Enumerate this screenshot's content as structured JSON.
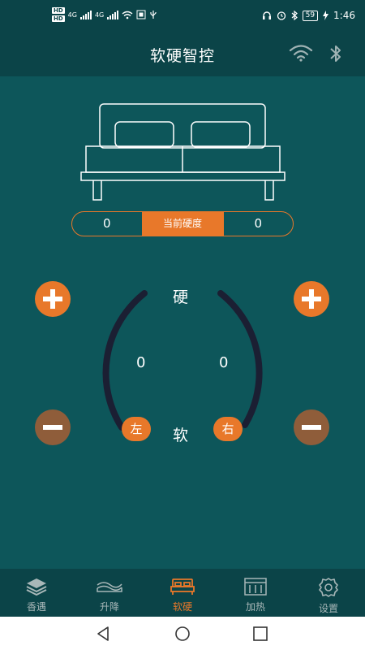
{
  "status_bar": {
    "hd1": "HD",
    "hd2": "HD",
    "net1": "4G",
    "net2": "4G",
    "battery": "59",
    "time": "1:46"
  },
  "header": {
    "title": "软硬智控",
    "icons": [
      "wifi-icon",
      "bluetooth-icon"
    ]
  },
  "hardness": {
    "left_value": "0",
    "label": "当前硬度",
    "right_value": "0"
  },
  "dial": {
    "top_label": "硬",
    "bottom_label": "软",
    "left_value": "0",
    "right_value": "0",
    "left_button": "左",
    "right_button": "右"
  },
  "tabs": [
    {
      "label": "香遇",
      "icon": "layers-icon",
      "active": false
    },
    {
      "label": "升降",
      "icon": "lift-icon",
      "active": false
    },
    {
      "label": "软硬",
      "icon": "bed-icon",
      "active": true
    },
    {
      "label": "加热",
      "icon": "heat-icon",
      "active": false
    },
    {
      "label": "设置",
      "icon": "gear-icon",
      "active": false
    }
  ],
  "colors": {
    "background": "#0d565a",
    "header": "#0b4448",
    "accent": "#e8782a",
    "minus": "#8f5d3a",
    "dial_arc": "#1b1f33"
  }
}
